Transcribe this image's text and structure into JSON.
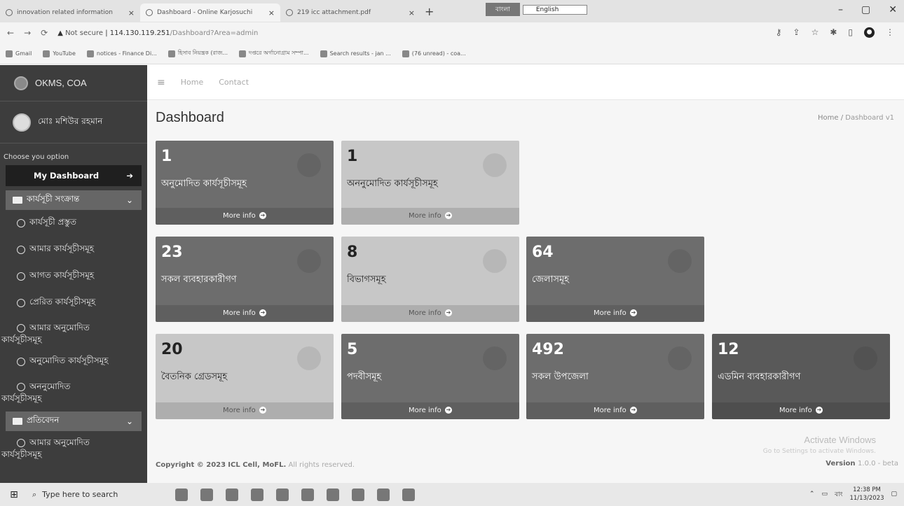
{
  "browser": {
    "tabs": [
      {
        "title": "innovation related information",
        "active": false
      },
      {
        "title": "Dashboard - Online Karjosuchi",
        "active": true
      },
      {
        "title": "219 icc attachment.pdf",
        "active": false
      }
    ],
    "new_tab": "+",
    "ime_lang_bn": "বাংলা",
    "ime_lang_en": "English",
    "url_not_secure": "Not secure",
    "url_host": "114.130.119.251",
    "url_path": "/Dashboard?Area=admin",
    "bookmarks": [
      "Gmail",
      "YouTube",
      "notices - Finance Di...",
      "হিসাব নিয়ন্ত্রক (রাজ...",
      "দপ্তরে অর্গানোগ্রাম সম্পা...",
      "Search results - jan ...",
      "(76 unread) - coa..."
    ]
  },
  "sidebar": {
    "brand": "OKMS, COA",
    "user_name": "মোঃ মশিউর রহমান",
    "choose_label": "Choose you option",
    "my_dashboard": "My Dashboard",
    "group1": "কার্যসূচী সংক্রান্ত",
    "items": [
      "কার্যসূচী প্রস্তুত",
      "আমার কার্যসূচীসমূহ",
      "আগত কার্যসূচীসমূহ",
      "প্রেরিত কার্যসূচীসমূহ"
    ],
    "item_my_approved_a": "আমার অনুমোদিত",
    "item_my_approved_b": "কার্যসূচীসমূহ",
    "item_approved": "অনুমোদিত কার্যসূচীসমূহ",
    "item_unapproved_a": "অননুমোদিত",
    "item_unapproved_b": "কার্যসূচীসমূহ",
    "group2": "প্রতিবেদন",
    "item_report_a": "আমার অনুমোদিত",
    "item_report_b": "কার্যসূচীসমূহ"
  },
  "topnav": {
    "home": "Home",
    "contact": "Contact"
  },
  "page": {
    "title": "Dashboard",
    "crumb_home": "Home",
    "crumb_sep": "/",
    "crumb_current": "Dashboard v1"
  },
  "boxes": [
    {
      "value": "1",
      "label": "অনুমোদিত কার্যসূচীসমূহ",
      "more": "More info"
    },
    {
      "value": "1",
      "label": "অননুমোদিত কার্যসূচীসমূহ",
      "more": "More info"
    },
    {
      "value": "23",
      "label": "সকল ব্যবহারকারীগণ",
      "more": "More info"
    },
    {
      "value": "8",
      "label": "বিভাগসমূহ",
      "more": "More info"
    },
    {
      "value": "64",
      "label": "জেলাসমূহ",
      "more": "More info"
    },
    {
      "value": "20",
      "label": "বৈতনিক গ্রেডসমূহ",
      "more": "More info"
    },
    {
      "value": "5",
      "label": "পদবীসমূহ",
      "more": "More info"
    },
    {
      "value": "492",
      "label": "সকল উপজেলা",
      "more": "More info"
    },
    {
      "value": "12",
      "label": "এডমিন ব্যবহারকারীগণ",
      "more": "More info"
    }
  ],
  "footer": {
    "copyright_prefix": "Copyright © 2023",
    "org": "ICL Cell, MoFL.",
    "rights": "All rights reserved.",
    "version_label": "Version",
    "version_value": "1.0.0 - beta",
    "activate_title": "Activate Windows",
    "activate_sub": "Go to Settings to activate Windows."
  },
  "taskbar": {
    "search_placeholder": "Type here to search",
    "lang": "বাং",
    "time": "12:38 PM",
    "date": "11/13/2023"
  }
}
